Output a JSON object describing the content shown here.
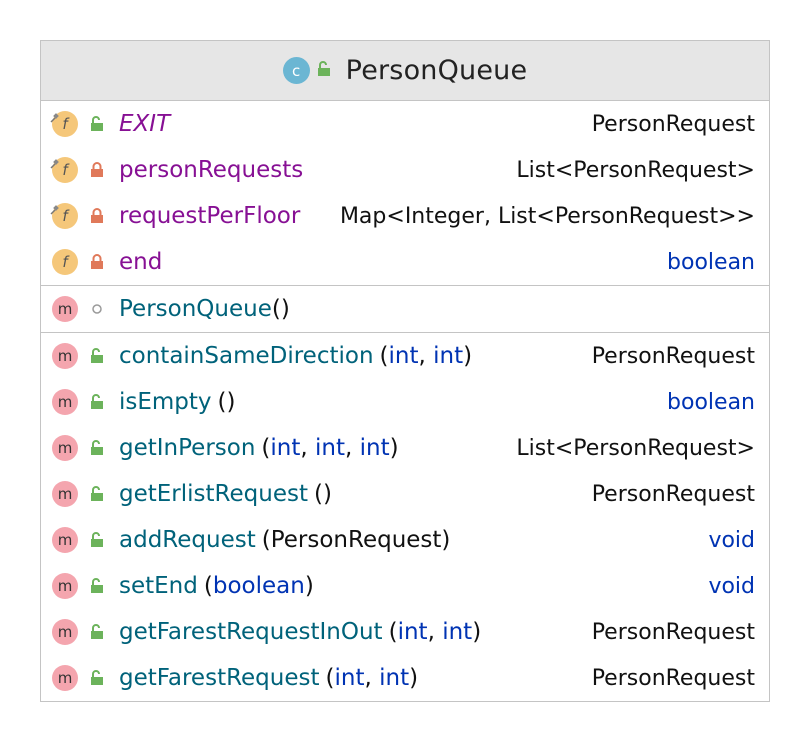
{
  "class": {
    "badge_letter": "c",
    "name": "PersonQueue"
  },
  "fields": [
    {
      "name": "EXIT",
      "italic": true,
      "visibility": "public",
      "pinned": true,
      "type": "PersonRequest",
      "type_kw": false
    },
    {
      "name": "personRequests",
      "italic": false,
      "visibility": "private",
      "pinned": true,
      "type": "List<PersonRequest>",
      "type_kw": false
    },
    {
      "name": "requestPerFloor",
      "italic": false,
      "visibility": "private",
      "pinned": true,
      "type": "Map<Integer, List<PersonRequest>>",
      "type_kw": false
    },
    {
      "name": "end",
      "italic": false,
      "visibility": "private",
      "pinned": false,
      "type": "boolean",
      "type_kw": true
    }
  ],
  "constructors": [
    {
      "name": "PersonQueue",
      "params": "()",
      "visibility": "package"
    }
  ],
  "methods": [
    {
      "name": "containSameDirection",
      "params": [
        "(",
        "int",
        ", ",
        "int",
        ")"
      ],
      "type": "PersonRequest",
      "type_kw": false
    },
    {
      "name": "isEmpty",
      "params": [
        "()"
      ],
      "type": "boolean",
      "type_kw": true
    },
    {
      "name": "getInPerson",
      "params": [
        "(",
        "int",
        ", ",
        "int",
        ", ",
        "int",
        ")"
      ],
      "type": "List<PersonRequest>",
      "type_kw": false
    },
    {
      "name": "getErlistRequest",
      "params": [
        "()"
      ],
      "type": "PersonRequest",
      "type_kw": false
    },
    {
      "name": "addRequest",
      "params": [
        "(PersonRequest)"
      ],
      "type": "void",
      "type_kw": true
    },
    {
      "name": "setEnd",
      "params": [
        "(",
        "boolean",
        ")"
      ],
      "type": "void",
      "type_kw": true
    },
    {
      "name": "getFarestRequestInOut",
      "params": [
        "(",
        "int",
        ", ",
        "int",
        ")"
      ],
      "type": "PersonRequest",
      "type_kw": false
    },
    {
      "name": "getFarestRequest",
      "params": [
        "(",
        "int",
        ", ",
        "int",
        ")"
      ],
      "type": "PersonRequest",
      "type_kw": false
    }
  ],
  "badges": {
    "field": "f",
    "method": "m"
  },
  "colors": {
    "field_name": "#871094",
    "method_name": "#00627a",
    "keyword": "#0033b3",
    "public_lock": "#6cb35b",
    "private_lock": "#e0795a",
    "field_badge": "#f5c77a",
    "method_badge": "#f4a5ae",
    "class_badge": "#6bb6d3"
  }
}
